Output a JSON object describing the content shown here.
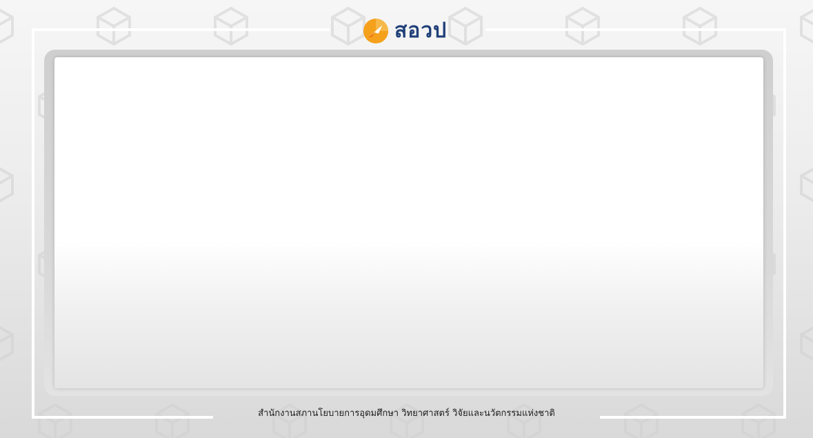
{
  "logo": {
    "text": "สอวป",
    "icon": "orange-arrow-circle-icon",
    "colors": {
      "icon": "#f5a11c",
      "icon_dark": "#ee7a1a",
      "text": "#1f3f78"
    }
  },
  "footer": {
    "org_name": "สำนักงานสภานโยบายการอุดมศึกษา วิทยาศาสตร์ วิจัยและนวัตกรรมแห่งชาติ"
  },
  "background": {
    "pattern_icon": "cube-outline-icon",
    "frame_color": "#ffffff"
  }
}
